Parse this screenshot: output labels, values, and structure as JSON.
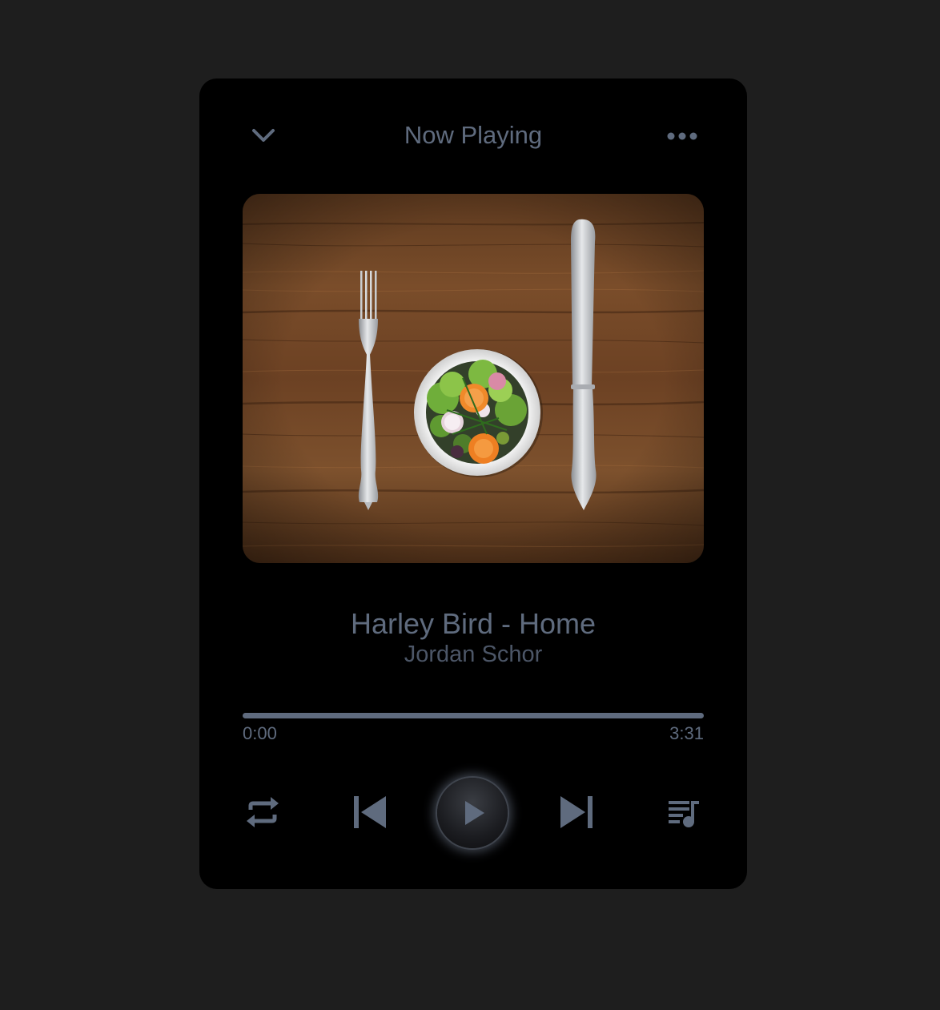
{
  "header": {
    "title": "Now Playing",
    "collapse_icon": "chevron-down-icon",
    "more_icon": "more-horizontal-icon"
  },
  "album_art": {
    "description_icon": "album-art-image"
  },
  "track": {
    "title": "Harley Bird - Home",
    "artist": "Jordan Schor"
  },
  "progress": {
    "current_time": "0:00",
    "total_time": "3:31",
    "fraction": 0
  },
  "controls": {
    "repeat_icon": "repeat-icon",
    "previous_icon": "skip-previous-icon",
    "play_icon": "play-icon",
    "next_icon": "skip-next-icon",
    "playlist_icon": "playlist-icon"
  },
  "colors": {
    "page_background": "#1e1e1e",
    "player_background": "#000000",
    "text_primary": "#5f6b7e",
    "text_secondary": "#4c5667",
    "icon": "#5f6b7e"
  }
}
